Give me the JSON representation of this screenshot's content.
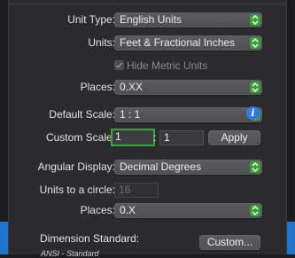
{
  "unit_type": {
    "label": "Unit Type:",
    "value": "English Units"
  },
  "units": {
    "label": "Units:",
    "value": "Feet & Fractional Inches"
  },
  "hide_metric": {
    "label": "Hide Metric Units",
    "checked": true
  },
  "places": {
    "label": "Places:",
    "value": "0.XX"
  },
  "default_scale": {
    "label": "Default Scale:",
    "value": "1 : 1"
  },
  "custom_scale": {
    "label": "Custom Scale:",
    "left_value": "1",
    "separator": ":",
    "right_value": "1",
    "apply_label": "Apply"
  },
  "angular_display": {
    "label": "Angular Display:",
    "value": "Decimal Degrees"
  },
  "units_to_circle": {
    "label": "Units to a circle:",
    "value": "16"
  },
  "angular_places": {
    "label": "Places:",
    "value": "0.X"
  },
  "dimension_standard": {
    "label": "Dimension Standard:",
    "button_label": "Custom...",
    "current": "ANSI - Standard"
  },
  "colors": {
    "accent_green": "#39a33a",
    "info_blue": "#2e7be6",
    "side_blue": "#1f74d0"
  }
}
